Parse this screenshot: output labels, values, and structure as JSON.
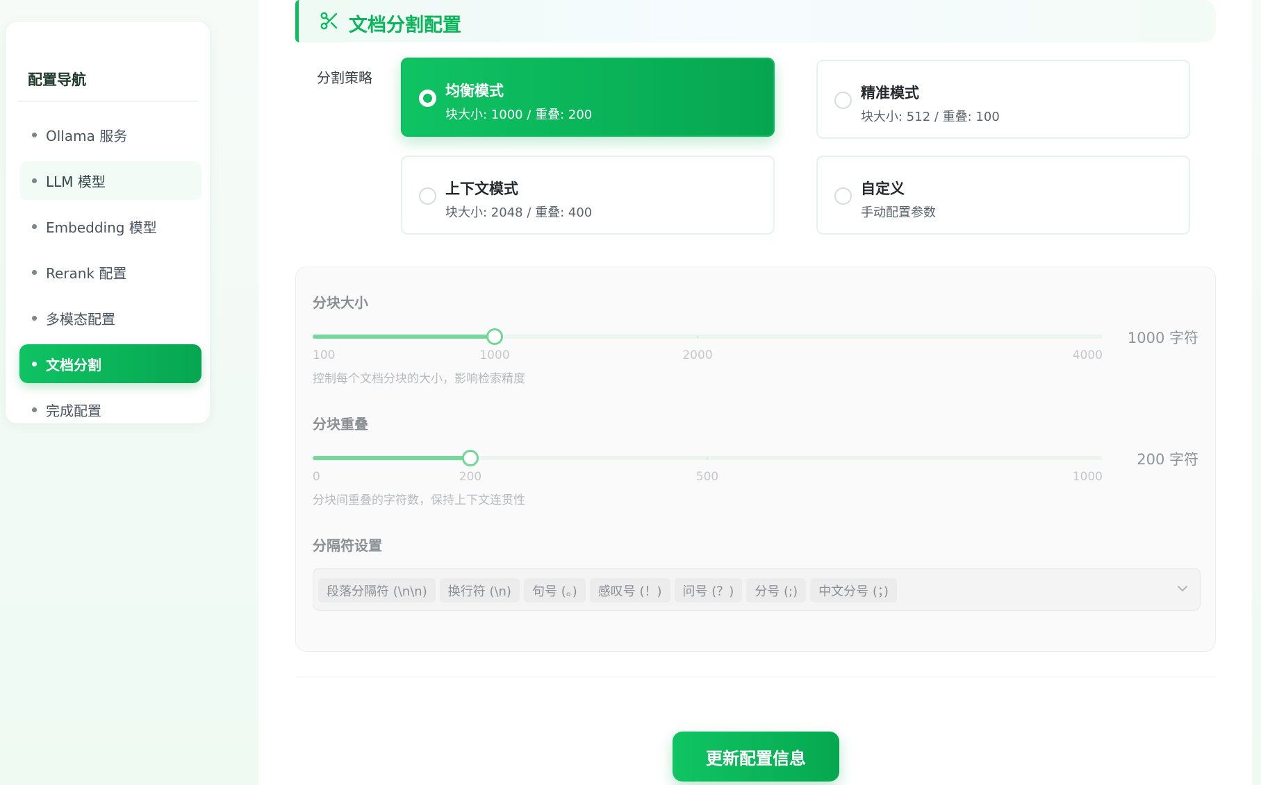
{
  "sidebar": {
    "title": "配置导航",
    "items": [
      {
        "label": "Ollama 服务",
        "state": "normal"
      },
      {
        "label": "LLM 模型",
        "state": "hover"
      },
      {
        "label": "Embedding 模型",
        "state": "normal"
      },
      {
        "label": "Rerank 配置",
        "state": "normal"
      },
      {
        "label": "多模态配置",
        "state": "normal"
      },
      {
        "label": "文档分割",
        "state": "active"
      },
      {
        "label": "完成配置",
        "state": "normal"
      }
    ]
  },
  "section": {
    "title": "文档分割配置",
    "icon": "scissors-icon",
    "accent_color": "#0bbf60"
  },
  "strategy": {
    "label": "分割策略",
    "options": [
      {
        "title": "均衡模式",
        "subtitle": "块大小: 1000 / 重叠: 200",
        "selected": true
      },
      {
        "title": "精准模式",
        "subtitle": "块大小: 512 / 重叠: 100",
        "selected": false
      },
      {
        "title": "上下文模式",
        "subtitle": "块大小: 2048 / 重叠: 400",
        "selected": false
      },
      {
        "title": "自定义",
        "subtitle": "手动配置参数",
        "selected": false
      }
    ]
  },
  "chunk_size": {
    "label": "分块大小",
    "min": 100,
    "max": 4000,
    "value": 1000,
    "value_text": "1000 字符",
    "marks": [
      "100",
      "1000",
      "2000",
      "4000"
    ],
    "help": "控制每个文档分块的大小，影响检索精度"
  },
  "chunk_overlap": {
    "label": "分块重叠",
    "min": 0,
    "max": 1000,
    "value": 200,
    "value_text": "200 字符",
    "marks": [
      "0",
      "200",
      "500",
      "1000"
    ],
    "help": "分块间重叠的字符数，保持上下文连贯性"
  },
  "separators": {
    "label": "分隔符设置",
    "tags": [
      "段落分隔符 (\\n\\n)",
      "换行符 (\\n)",
      "句号 (。)",
      "感叹号 (！)",
      "问号 (？)",
      "分号 (;)",
      "中文分号 (；)"
    ],
    "dropdown_icon": "chevron-down-icon"
  },
  "actions": {
    "update_label": "更新配置信息"
  }
}
